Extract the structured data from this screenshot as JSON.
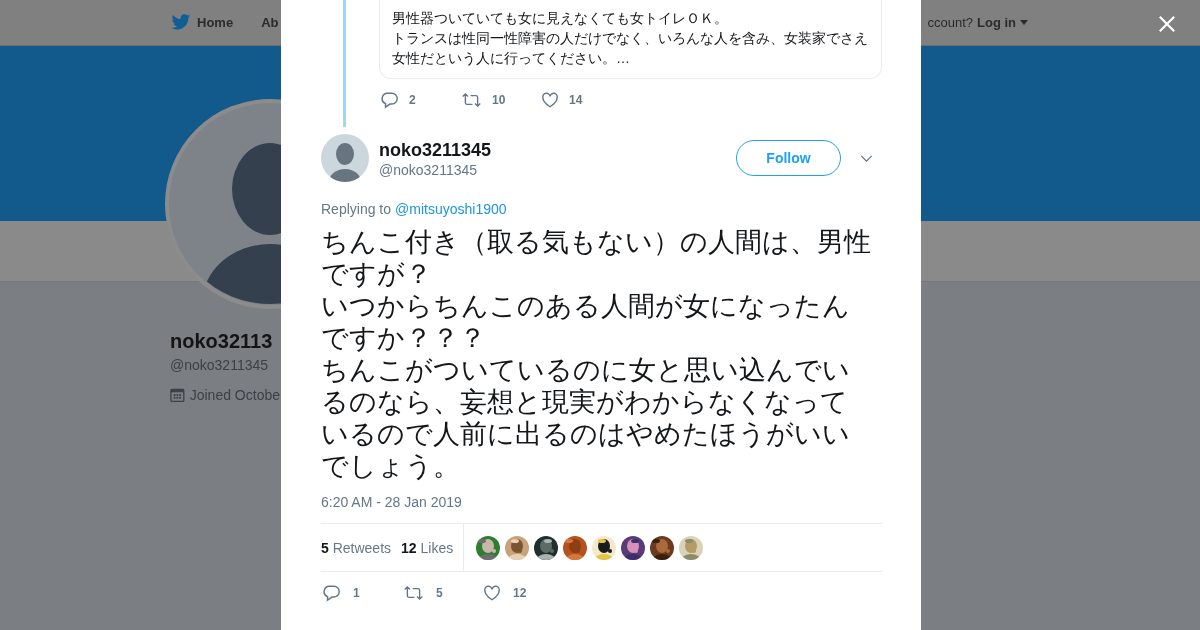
{
  "background_page": {
    "nav": {
      "home": "Home",
      "about": "Ab",
      "login_prompt": "ccount?",
      "login": "Log in"
    },
    "profile": {
      "name": "noko32113",
      "handle": "@noko3211345",
      "joined": "Joined Octobe"
    }
  },
  "quoted_tweet": {
    "lines": [
      "男性器ついていても女に見えなくても女トイレＯＫ。",
      "トランスは性同一性障害の人だけでなく、いろんな人を含み、女装家でさえ女性だという人に行ってください。…"
    ],
    "replies": "2",
    "retweets": "10",
    "likes": "14"
  },
  "tweet": {
    "name": "noko3211345",
    "handle": "@noko3211345",
    "follow": "Follow",
    "replying_label": "Replying to",
    "replying_to": "@mitsuyoshi1900",
    "paragraphs": [
      "ちんこ付き（取る気もない）の人間は、男性",
      "ですが？",
      "いつからちんこのある人間が女になったん",
      "ですか？？？",
      "ちんこがついているのに女と思い込んでい",
      "るのなら、妄想と現実がわからなくなって",
      "いるので人前に出るのはやめたほうがいい",
      "でしょう。"
    ],
    "timestamp": "6:20 AM - 28 Jan 2019",
    "stats": [
      {
        "count": "5",
        "label": "Retweets"
      },
      {
        "count": "12",
        "label": "Likes"
      }
    ],
    "replies": "1",
    "retweets": "5",
    "likes": "12"
  }
}
